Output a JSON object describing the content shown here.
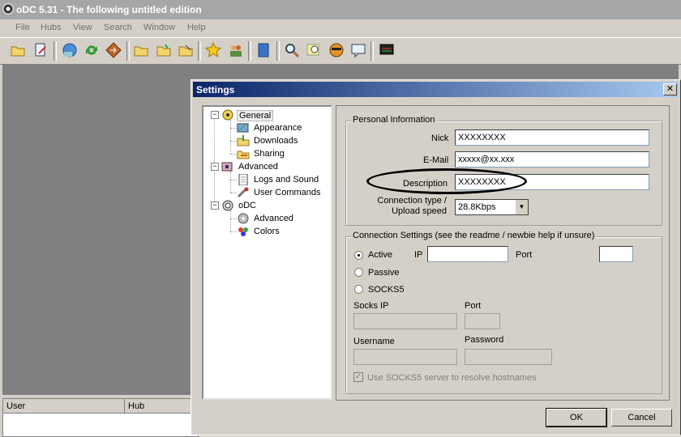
{
  "window": {
    "title": "oDC 5.31 - The following untitled edition"
  },
  "menu": [
    "File",
    "Hubs",
    "View",
    "Search",
    "Window",
    "Help"
  ],
  "toolbar_icons": [
    "open-folder-icon",
    "edit-doc-icon",
    "network-globe-icon",
    "refresh-icon",
    "diamond-arrow-icon",
    "folder-icon",
    "folder-star-icon",
    "folder-edit-icon",
    "favorite-star-icon",
    "users-icon",
    "book-icon",
    "search-icon",
    "magnify-doc-icon",
    "avatar-face-icon",
    "chat-icon",
    "monitor-icon"
  ],
  "userlist": {
    "col_user": "User",
    "col_hub": "Hub"
  },
  "dialog": {
    "title": "Settings",
    "close_glyph": "✕",
    "tree": {
      "general": "General",
      "appearance": "Appearance",
      "downloads": "Downloads",
      "sharing": "Sharing",
      "advanced": "Advanced",
      "logs": "Logs and Sound",
      "user_commands": "User Commands",
      "odc": "oDC",
      "odc_advanced": "Advanced",
      "colors": "Colors"
    },
    "personal": {
      "group_title": "Personal Information",
      "nick_label": "Nick",
      "nick_value": "XXXXXXXX",
      "email_label": "E-Mail",
      "email_value": "xxxxx@xx.xxx",
      "desc_label": "Description",
      "desc_value": "XXXXXXXX",
      "conn_label_1": "Connection type /",
      "conn_label_2": "Upload speed",
      "conn_value": "28.8Kbps"
    },
    "connection": {
      "group_title": "Connection Settings (see the readme / newbie help if unsure)",
      "active": "Active",
      "passive": "Passive",
      "socks5": "SOCKS5",
      "ip_label": "IP",
      "port_label": "Port",
      "socks_ip_label": "Socks IP",
      "socks_port_label": "Port",
      "username_label": "Username",
      "password_label": "Password",
      "use_socks_label": "Use SOCKS5 server to resolve hostnames",
      "selected_mode": "Active"
    },
    "ok_label": "OK",
    "cancel_label": "Cancel"
  }
}
